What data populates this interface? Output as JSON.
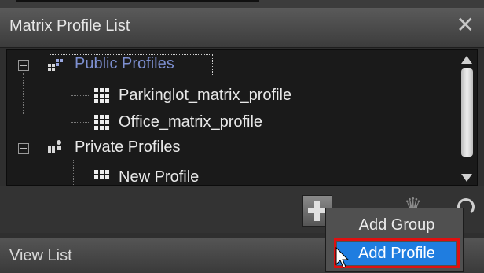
{
  "panel": {
    "title": "Matrix Profile List",
    "close_symbol": "✕"
  },
  "tree": {
    "public_group": {
      "label": "Public Profiles",
      "selected": true,
      "icon": "group-icon",
      "children": [
        {
          "label": "Parkinglot_matrix_profile",
          "icon": "grid-icon"
        },
        {
          "label": "Office_matrix_profile",
          "icon": "grid-icon"
        }
      ]
    },
    "private_group": {
      "label": "Private Profiles",
      "icon": "group-icon",
      "children": [
        {
          "label": "New Profile",
          "icon": "grid-icon"
        }
      ]
    }
  },
  "toolbar": {
    "add_icon": "plus-icon",
    "other_icon": "crown-icon",
    "refresh_icon": "refresh-icon"
  },
  "context_menu": {
    "items": [
      {
        "label": "Add Group"
      },
      {
        "label": "Add Profile",
        "highlighted": true
      }
    ]
  },
  "view_list": {
    "label": "View List"
  },
  "colors": {
    "selected_text": "#7d8fd0",
    "menu_highlight": "#1f7de0",
    "annotation_box": "#e01010"
  }
}
